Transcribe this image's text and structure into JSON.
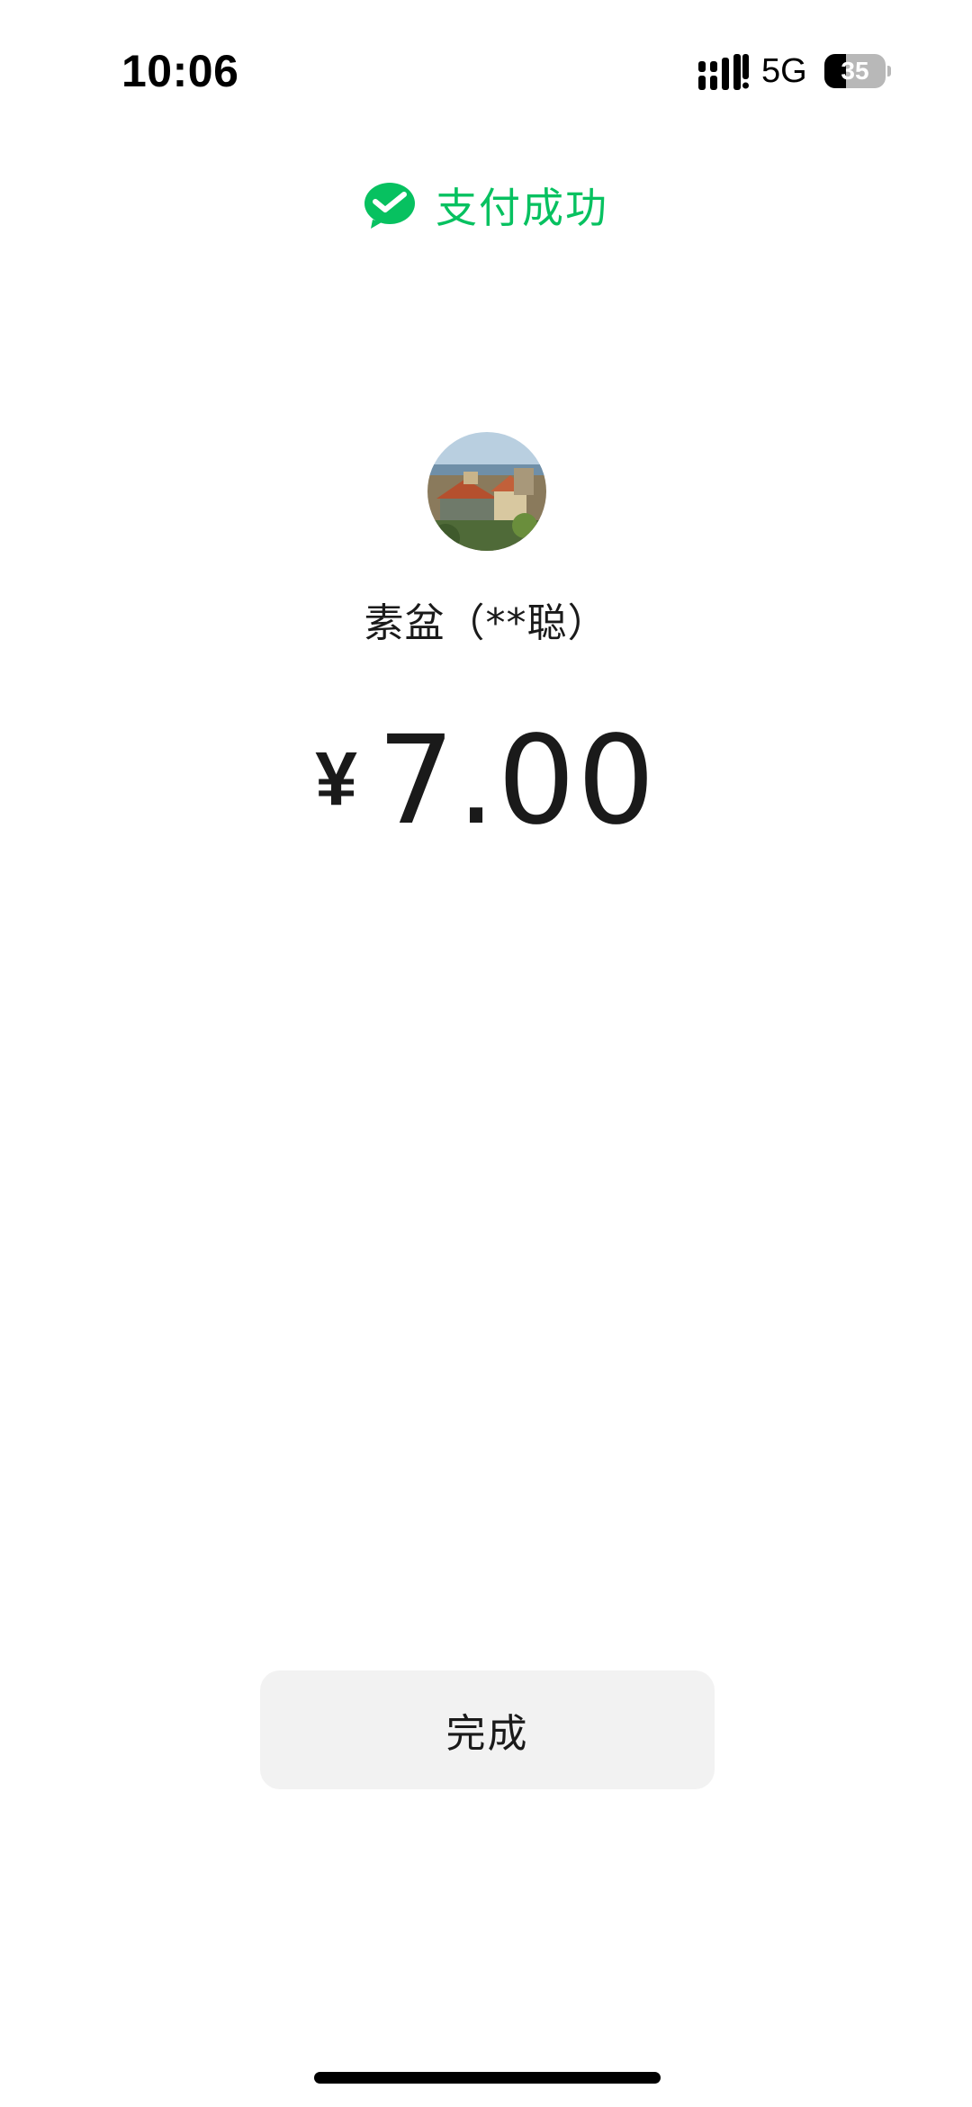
{
  "status_bar": {
    "time": "10:06",
    "network": "5G",
    "battery_level": "35",
    "battery_percent": 35
  },
  "header": {
    "icon": "wechat-pay-icon",
    "title": "支付成功",
    "accent_color": "#07c160"
  },
  "payee": {
    "avatar": "avatar-image",
    "name": "素盆（**聪）"
  },
  "amount": {
    "currency_symbol": "¥",
    "value": "7.00"
  },
  "actions": {
    "done_label": "完成"
  }
}
